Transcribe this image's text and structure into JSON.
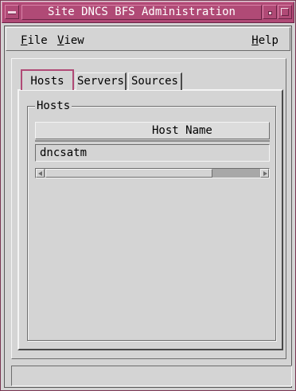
{
  "window": {
    "title": "Site DNCS BFS Administration"
  },
  "menubar": {
    "file": {
      "mnemonic": "F",
      "rest": "ile"
    },
    "view": {
      "mnemonic": "V",
      "rest": "iew"
    },
    "help": {
      "mnemonic": "H",
      "rest": "elp"
    }
  },
  "tabs": [
    {
      "label": "Hosts",
      "selected": true
    },
    {
      "label": "Servers",
      "selected": false
    },
    {
      "label": "Sources",
      "selected": false
    }
  ],
  "hosts_group": {
    "label": "Hosts",
    "column_header": "Host Name",
    "rows": [
      "dncsatm"
    ],
    "hscroll_thumb_fraction": 0.78
  },
  "statusbar": {
    "text": ""
  },
  "colors": {
    "titlebar": "#b04a76",
    "background": "#d4d4d4",
    "selected_tab_border": "#b04a76"
  },
  "icons": {
    "window_menu": "window-menu-icon",
    "minimize": "minimize-icon",
    "maximize": "maximize-icon",
    "scroll_left": "arrow-left-icon",
    "scroll_right": "arrow-right-icon"
  }
}
